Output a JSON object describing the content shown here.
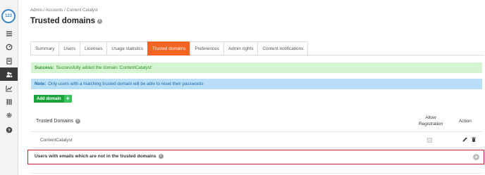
{
  "app": {
    "logo_text": "123"
  },
  "sidebar": {
    "items": [
      {
        "icon": "list-icon",
        "active": false
      },
      {
        "icon": "gauge-icon",
        "active": false
      },
      {
        "icon": "document-icon",
        "active": false
      },
      {
        "icon": "users-icon",
        "active": true
      },
      {
        "icon": "chart-icon",
        "active": false
      },
      {
        "icon": "library-icon",
        "active": false
      },
      {
        "icon": "gear-icon",
        "active": false
      },
      {
        "icon": "help-icon",
        "active": false
      }
    ]
  },
  "breadcrumb": "Admin / Accounts / Content Catalyst",
  "page": {
    "title": "Trusted domains"
  },
  "tabs": [
    {
      "label": "Summary",
      "active": false
    },
    {
      "label": "Users",
      "active": false
    },
    {
      "label": "Licenses",
      "active": false
    },
    {
      "label": "Usage statistics",
      "active": false
    },
    {
      "label": "Trusted domains",
      "active": true
    },
    {
      "label": "Preferences",
      "active": false
    },
    {
      "label": "Admin rights",
      "active": false
    },
    {
      "label": "Content notifications",
      "active": false
    }
  ],
  "alerts": {
    "success_label": "Success:",
    "success_text": "Successfully added the domain 'ContentCatalyst'",
    "info_label": "Note:",
    "info_text": "Only users with a matching trusted domain will be able to reset their passwords"
  },
  "add_button": {
    "label": "Add domain",
    "icon": "+"
  },
  "table": {
    "headers": {
      "domains": "Trusted Domains",
      "allow_line1": "Allow",
      "allow_line2": "Registration",
      "action": "Action"
    },
    "rows": [
      {
        "domain": "ContentCatalyst",
        "allow_registration": true
      }
    ]
  },
  "section": {
    "title": "Users with emails which are not in the trusted domains"
  },
  "colors": {
    "accent": "#f26522",
    "success_bg": "#d5f5d2",
    "info_bg": "#b8dff7",
    "button": "#1aa33b",
    "highlight_border": "#c0272d"
  }
}
